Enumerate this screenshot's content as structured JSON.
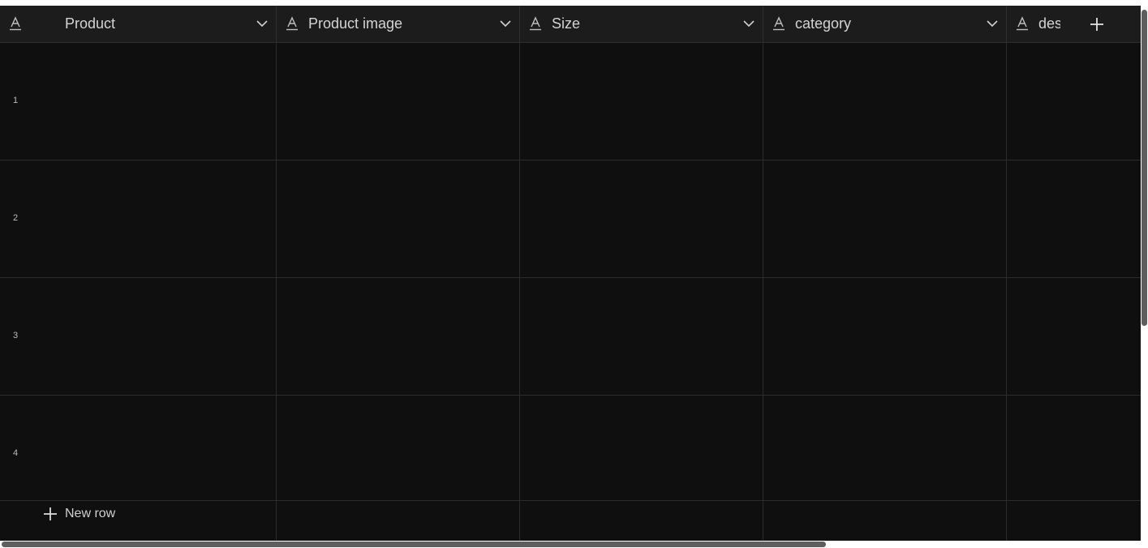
{
  "columns": [
    {
      "label": "Product",
      "type_icon": "text-type-icon",
      "menu_icon": "chevron-down-icon"
    },
    {
      "label": "Product image",
      "type_icon": "text-type-icon",
      "menu_icon": "chevron-down-icon"
    },
    {
      "label": "Size",
      "type_icon": "text-type-icon",
      "menu_icon": "chevron-down-icon"
    },
    {
      "label": "category",
      "type_icon": "text-type-icon",
      "menu_icon": "chevron-down-icon"
    },
    {
      "label": "des",
      "type_icon": "text-type-icon"
    }
  ],
  "add_column_icon": "plus-icon",
  "rows": [
    {
      "number": "1"
    },
    {
      "number": "2"
    },
    {
      "number": "3"
    },
    {
      "number": "4"
    }
  ],
  "new_row": {
    "label": "New row",
    "icon": "plus-icon"
  },
  "colors": {
    "background": "#0f0f0f",
    "header_background": "#1c1c1c",
    "grid_line": "#2b2b2b",
    "text": "#d4d4d4",
    "scrollbar_thumb": "#5e5e5e"
  }
}
